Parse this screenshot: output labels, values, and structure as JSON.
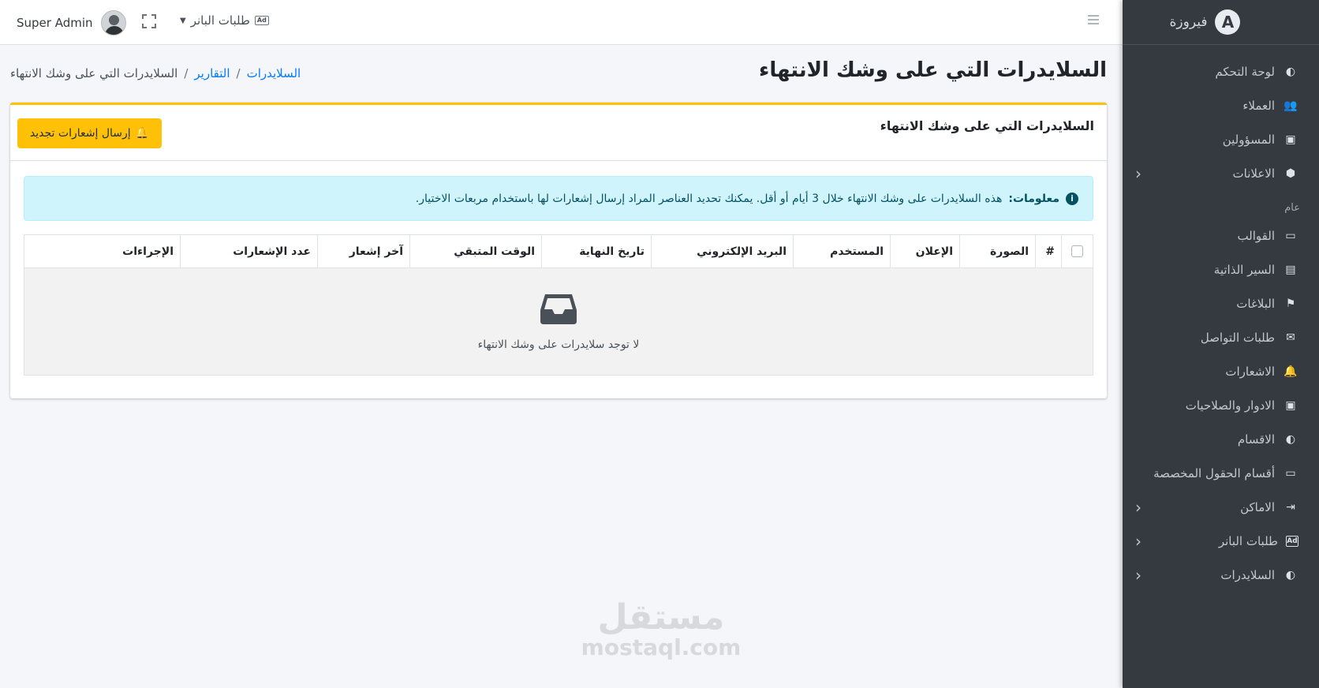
{
  "sidebar": {
    "brand": "فيروزة",
    "items": [
      {
        "label": "لوحة التحكم",
        "icon": "palette-icon",
        "glyph": "◐",
        "chevron": false
      },
      {
        "label": "العملاء",
        "icon": "users-icon",
        "glyph": "👥",
        "chevron": false
      },
      {
        "label": "المسؤولين",
        "icon": "id-card-icon",
        "glyph": "▣",
        "chevron": false
      },
      {
        "label": "الاعلانات",
        "icon": "cube-icon",
        "glyph": "⬢",
        "chevron": true
      }
    ],
    "section_header": "عام",
    "items2": [
      {
        "label": "القوالب",
        "icon": "folder-icon",
        "glyph": "▭",
        "chevron": false
      },
      {
        "label": "السير الذاتية",
        "icon": "resume-icon",
        "glyph": "▤",
        "chevron": false
      },
      {
        "label": "البلاغات",
        "icon": "flag-icon",
        "glyph": "⚑",
        "chevron": false
      },
      {
        "label": "طلبات التواصل",
        "icon": "envelope-icon",
        "glyph": "✉",
        "chevron": false
      },
      {
        "label": "الاشعارات",
        "icon": "bell-icon",
        "glyph": "🔔",
        "chevron": false
      },
      {
        "label": "الادوار والصلاحيات",
        "icon": "role-card-icon",
        "glyph": "▣",
        "chevron": false
      },
      {
        "label": "الاقسام",
        "icon": "palette-icon",
        "glyph": "◐",
        "chevron": false
      },
      {
        "label": "أقسام الحقول المخصصة",
        "icon": "folder-plus-icon",
        "glyph": "▭",
        "chevron": false
      },
      {
        "label": "الاماكن",
        "icon": "sign-in-icon",
        "glyph": "⇥",
        "chevron": true
      },
      {
        "label": "طلبات البانر",
        "icon": "ad-icon",
        "glyph": "Ad",
        "chevron": true
      },
      {
        "label": "السلايدرات",
        "icon": "palette-icon",
        "glyph": "◐",
        "chevron": true
      }
    ]
  },
  "topbar": {
    "user_name": "Super Admin",
    "dropdown_label": "طلبات البانر",
    "ad_badge": "Ad"
  },
  "header": {
    "title": "السلايدرات التي على وشك الانتهاء",
    "breadcrumb": {
      "link1": "السلايدرات",
      "link2": "التقارير",
      "active": "السلايدرات التي على وشك الانتهاء",
      "separator": "/"
    }
  },
  "card": {
    "title": "السلايدرات التي على وشك الانتهاء",
    "button_label": "إرسال إشعارات تجديد",
    "alert_strong": "معلومات:",
    "alert_text": "هذه السلايدرات على وشك الانتهاء خلال 3 أيام أو أقل. يمكنك تحديد العناصر المراد إرسال إشعارات لها باستخدام مربعات الاختيار.",
    "columns": [
      "#",
      "الصورة",
      "الإعلان",
      "المستخدم",
      "البريد الإلكتروني",
      "تاريخ النهاية",
      "الوقت المتبقي",
      "آخر إشعار",
      "عدد الإشعارات",
      "الإجراءات"
    ],
    "empty_text": "لا توجد سلايدرات على وشك الانتهاء"
  },
  "watermark": {
    "arabic": "مستقل",
    "latin": "mostaql.com"
  },
  "colors": {
    "sidebar_bg": "#343a40",
    "card_accent": "#ffc107",
    "link": "#007bff",
    "alert_bg": "#cff4fc"
  }
}
